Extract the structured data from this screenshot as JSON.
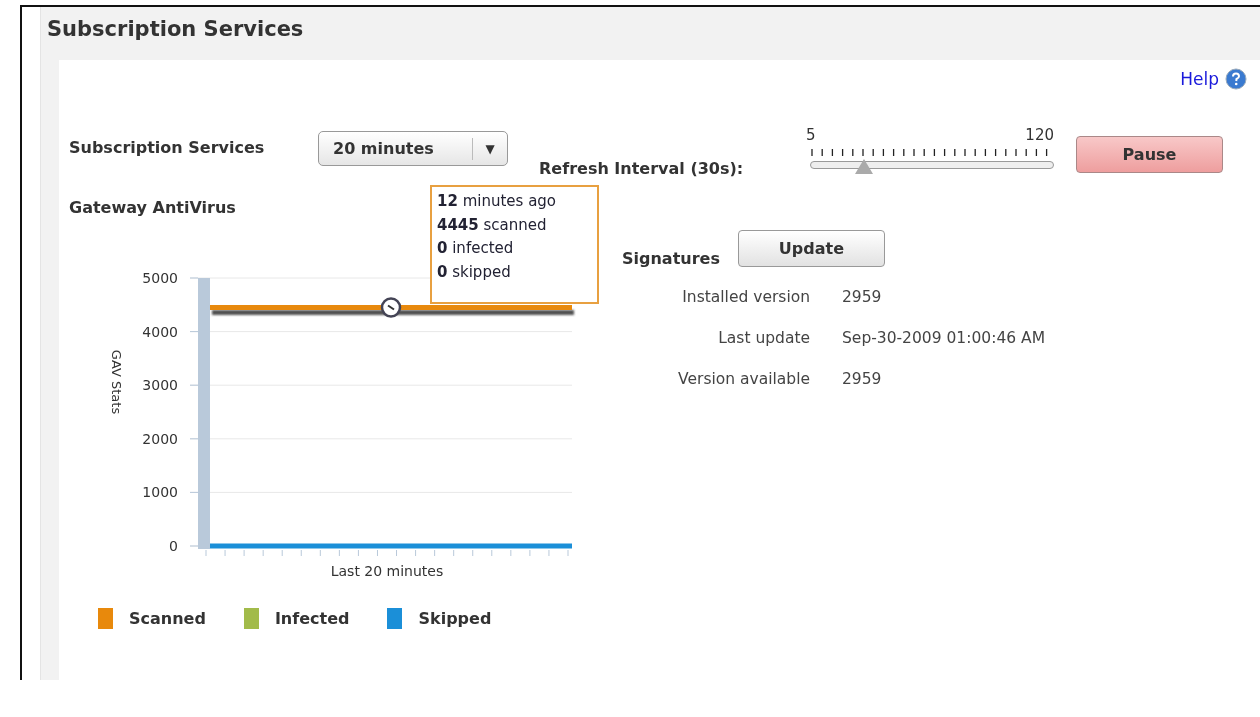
{
  "page": {
    "title": "Subscription Services"
  },
  "help": {
    "label": "Help"
  },
  "controls": {
    "label": "Subscription Services",
    "dropdown": {
      "value": "20 minutes",
      "arrow": "▼"
    },
    "refresh": {
      "label": "Refresh Interval (30s):",
      "min": "5",
      "max": "120",
      "level": 0.22
    },
    "pause_button": "Pause"
  },
  "gateway_antivirus": {
    "title": "Gateway AntiVirus",
    "tooltip": [
      "**12** minutes ago",
      "**4445** scanned",
      "**0** infected",
      "**0** skipped"
    ],
    "chart_data": {
      "type": "line",
      "xlabel": "Last 20 minutes",
      "ylabel": "GAV Stats",
      "ylim": [
        0,
        5000
      ],
      "yticks": [
        0,
        1000,
        2000,
        3000,
        4000,
        5000
      ],
      "grid": true,
      "series": [
        {
          "name": "Scanned",
          "color": "#e8890c",
          "values": [
            4450,
            4450,
            4450,
            4450,
            4450,
            4450,
            4450,
            4450,
            4450,
            4450,
            4450,
            4450,
            4450,
            4450,
            4450,
            4450,
            4450,
            4450,
            4450,
            4450
          ]
        },
        {
          "name": "Infected",
          "color": "#a2bb4a",
          "values": [
            null,
            null,
            null,
            null,
            null,
            null,
            null,
            null,
            null,
            null,
            null,
            null,
            null,
            null,
            null,
            null,
            null,
            null,
            null,
            null
          ]
        },
        {
          "name": "Skipped",
          "color": "#1b8fd8",
          "values": [
            0,
            0,
            0,
            0,
            0,
            0,
            0,
            0,
            0,
            0,
            0,
            0,
            0,
            0,
            0,
            0,
            0,
            0,
            0,
            0
          ]
        }
      ]
    }
  },
  "signatures": {
    "title": "Signatures",
    "button": "Update",
    "rows": [
      {
        "label": "Installed version",
        "value": "2959"
      },
      {
        "label": "Last update",
        "value": "Sep-30-2009 01:00:46 AM"
      },
      {
        "label": "Version available",
        "value": "2959"
      }
    ]
  }
}
